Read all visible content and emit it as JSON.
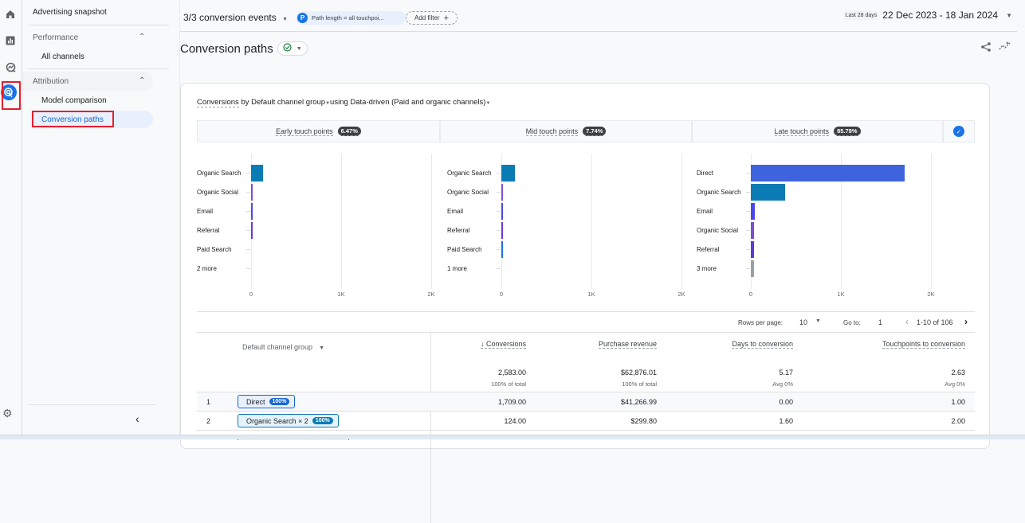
{
  "rail": {
    "icons": [
      "home-icon",
      "reports-icon",
      "explore-icon",
      "advertising-icon"
    ],
    "settings_icon": "gear-icon"
  },
  "nav": {
    "top_item": "Advertising snapshot",
    "sections": [
      {
        "label": "Performance",
        "items": [
          "All channels"
        ]
      },
      {
        "label": "Attribution",
        "items": [
          "Model comparison",
          "Conversion paths"
        ]
      }
    ],
    "active_item": "Conversion paths",
    "collapse_glyph": "‹"
  },
  "topbar": {
    "events_label": "3/3 conversion events",
    "filter_chip_letter": "P",
    "filter_chip_text": "Path length = all touchpoi...",
    "add_filter_label": "Add filter",
    "date_preset": "Last 28 days",
    "date_range": "22 Dec 2023 - 18 Jan 2024"
  },
  "page": {
    "title": "Conversion paths",
    "status_icon": "✓"
  },
  "card": {
    "heading_metric": "Conversions",
    "heading_by": " by ",
    "heading_dimension": "Default channel group",
    "heading_using": "using Data-driven (Paid and organic channels)"
  },
  "stages": [
    {
      "label": "Early touch points",
      "pct": "6.47%"
    },
    {
      "label": "Mid touch points",
      "pct": "7.74%"
    },
    {
      "label": "Late touch points",
      "pct": "85.79%"
    }
  ],
  "chart_data": [
    {
      "type": "bar",
      "title": "Early touch points",
      "categories": [
        "Organic Search",
        "Organic Social",
        "Email",
        "Referral",
        "Paid Search",
        "2 more"
      ],
      "values": [
        130,
        8,
        8,
        8,
        0,
        0
      ],
      "colors": [
        "#0b7bb5",
        "#7b4fd6",
        "#4a48e8",
        "#6a3bd0",
        "#1a73e8",
        "#9aa0a6"
      ],
      "xticks": [
        "0",
        "1K",
        "2K"
      ],
      "xlim": [
        0,
        2000
      ],
      "grid": true
    },
    {
      "type": "bar",
      "title": "Mid touch points",
      "categories": [
        "Organic Search",
        "Organic Social",
        "Email",
        "Referral",
        "Paid Search",
        "1 more"
      ],
      "values": [
        150,
        10,
        10,
        8,
        6,
        0
      ],
      "colors": [
        "#0b7bb5",
        "#7b4fd6",
        "#4a48e8",
        "#6a3bd0",
        "#1a73e8",
        "#9aa0a6"
      ],
      "xticks": [
        "0",
        "1K",
        "2K"
      ],
      "xlim": [
        0,
        2000
      ],
      "grid": true
    },
    {
      "type": "bar",
      "title": "Late touch points",
      "categories": [
        "Direct",
        "Organic Search",
        "Email",
        "Organic Social",
        "Referral",
        "3 more"
      ],
      "values": [
        1709,
        380,
        40,
        38,
        35,
        35
      ],
      "colors": [
        "#3d63dd",
        "#0b7bb5",
        "#4a48e8",
        "#7b4fd6",
        "#5b3bd6",
        "#9aa0a6"
      ],
      "xticks": [
        "0",
        "1K",
        "2K"
      ],
      "xlim": [
        0,
        2000
      ],
      "grid": true
    }
  ],
  "pager": {
    "rows_per_page_label": "Rows per page:",
    "rows_per_page_value": "10",
    "goto_label": "Go to:",
    "goto_value": "1",
    "range_text": "1-10 of 106"
  },
  "table": {
    "dimension_header": "Default channel group",
    "columns": [
      {
        "label": "Conversions",
        "sorted": "desc",
        "total": "2,583.00",
        "sub": "100% of total"
      },
      {
        "label": "Purchase revenue",
        "total": "$62,876.01",
        "sub": "100% of total"
      },
      {
        "label": "Days to conversion",
        "total": "5.17",
        "sub": "Avg 0%"
      },
      {
        "label": "Touchpoints to conversion",
        "total": "2.63",
        "sub": "Avg 0%"
      }
    ],
    "sort_glyph": "↓",
    "rows": [
      {
        "index": "1",
        "path": "Direct",
        "pct": "100%",
        "conversions": "1,709.00",
        "revenue": "$41,266.99",
        "days": "0.00",
        "touchpoints": "1.00"
      },
      {
        "index": "2",
        "path": "Organic Search × 2",
        "pct": "100%",
        "conversions": "124.00",
        "revenue": "$299.80",
        "days": "1.60",
        "touchpoints": "2.00"
      }
    ]
  }
}
